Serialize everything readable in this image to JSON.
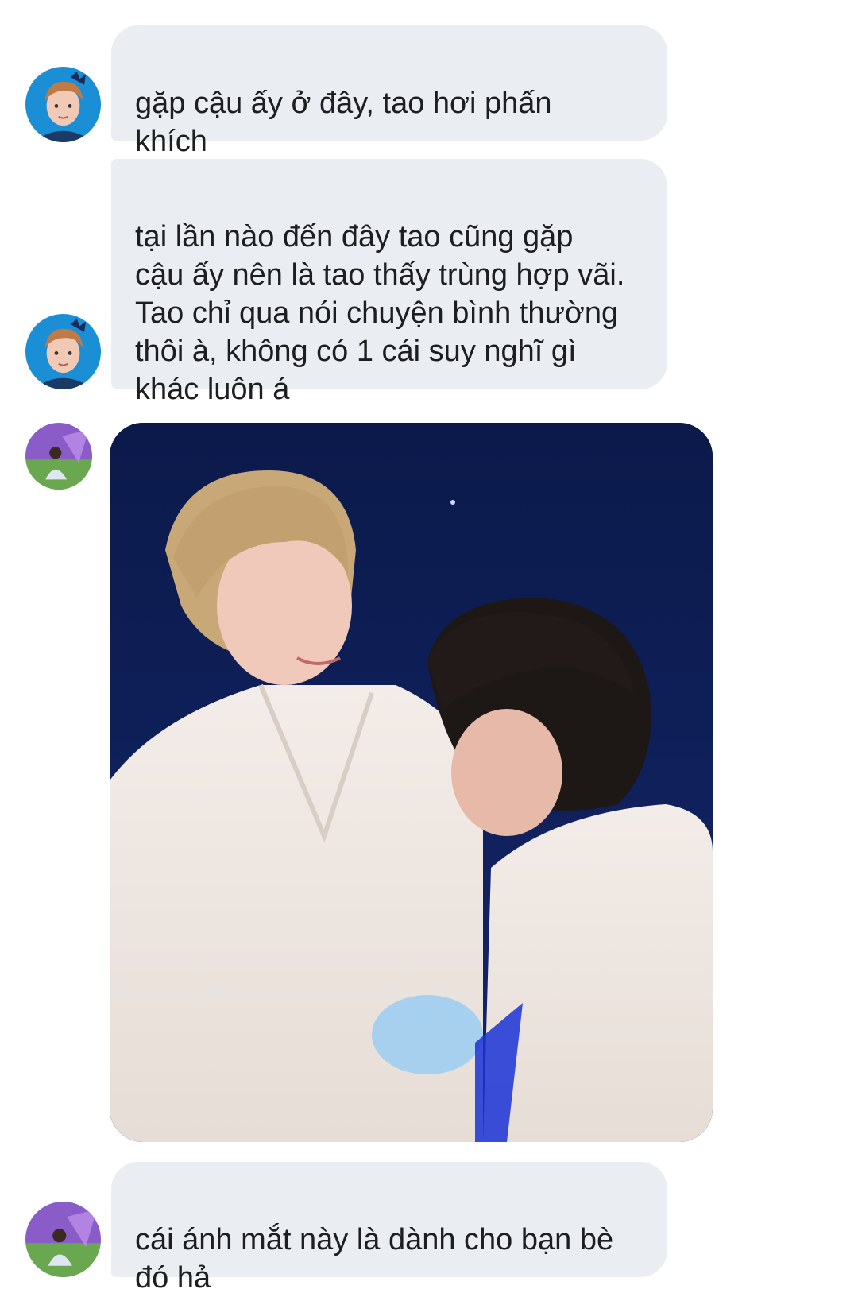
{
  "messages": [
    {
      "sender": "friend-1",
      "type": "text",
      "text": "gặp cậu ấy ở đây, tao hơi phấn\nkhích"
    },
    {
      "sender": "friend-1",
      "type": "text",
      "text": "tại lần nào đến đây tao cũng gặp\ncậu ấy nên là tao thấy trùng hợp vãi.\nTao chỉ qua nói chuyện bình thường\nthôi à, không có 1 cái suy nghĩ gì\nkhác luôn á"
    },
    {
      "sender": "friend-2",
      "type": "image",
      "image_desc": "photo"
    },
    {
      "sender": "friend-2",
      "type": "text",
      "text": "cái ánh mắt này là dành cho bạn bè\nđó hả"
    }
  ],
  "colors": {
    "bubble_bg": "#eaedf1",
    "text": "#1c1e21",
    "avatar1_bg": "#1a8fd6",
    "avatar2_bg": "#8a5cc8",
    "photo_bg": "#0c1a4f"
  },
  "icons": [
    "avatar-friend-1",
    "avatar-friend-2"
  ]
}
